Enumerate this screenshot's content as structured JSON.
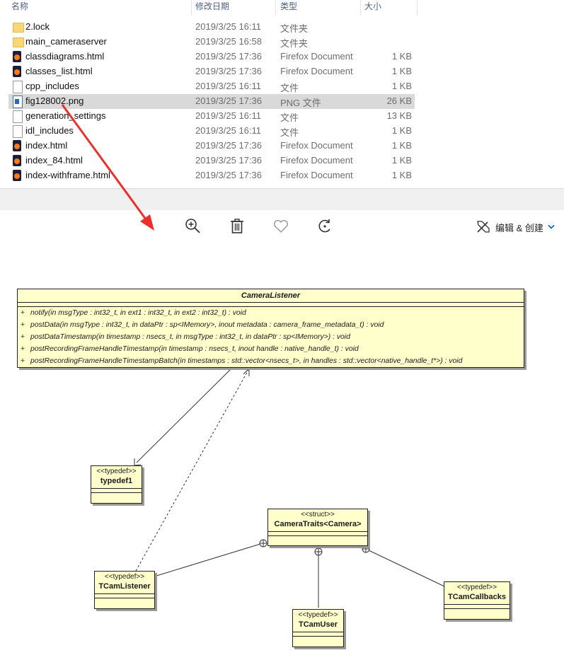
{
  "explorer": {
    "columns": {
      "name": "名称",
      "date": "修改日期",
      "type": "类型",
      "size": "大小"
    },
    "files": [
      {
        "icon": "folder-icon",
        "name": "2.lock",
        "date": "2019/3/25 16:11",
        "type": "文件夹",
        "size": ""
      },
      {
        "icon": "folder-icon",
        "name": "main_cameraserver",
        "date": "2019/3/25 16:58",
        "type": "文件夹",
        "size": ""
      },
      {
        "icon": "firefox-html-icon",
        "name": "classdiagrams.html",
        "date": "2019/3/25 17:36",
        "type": "Firefox Document",
        "size": "1 KB"
      },
      {
        "icon": "firefox-html-icon",
        "name": "classes_list.html",
        "date": "2019/3/25 17:36",
        "type": "Firefox Document",
        "size": "1 KB"
      },
      {
        "icon": "file-icon",
        "name": "cpp_includes",
        "date": "2019/3/25 16:11",
        "type": "文件",
        "size": "1 KB"
      },
      {
        "icon": "png-image-icon",
        "name": "fig128002.png",
        "date": "2019/3/25 17:36",
        "type": "PNG 文件",
        "size": "26 KB",
        "selected": true
      },
      {
        "icon": "file-icon",
        "name": "generation_settings",
        "date": "2019/3/25 16:11",
        "type": "文件",
        "size": "13 KB"
      },
      {
        "icon": "file-icon",
        "name": "idl_includes",
        "date": "2019/3/25 16:11",
        "type": "文件",
        "size": "1 KB"
      },
      {
        "icon": "firefox-html-icon",
        "name": "index.html",
        "date": "2019/3/25 17:36",
        "type": "Firefox Document",
        "size": "1 KB"
      },
      {
        "icon": "firefox-html-icon",
        "name": "index_84.html",
        "date": "2019/3/25 17:36",
        "type": "Firefox Document",
        "size": "1 KB"
      },
      {
        "icon": "firefox-html-icon",
        "name": "index-withframe.html",
        "date": "2019/3/25 17:36",
        "type": "Firefox Document",
        "size": "1 KB"
      }
    ]
  },
  "viewer": {
    "toolbar": {
      "zoom_icon": "zoom-in-icon",
      "delete_icon": "trash-icon",
      "favorite_icon": "heart-icon",
      "rotate_icon": "rotate-icon",
      "edit_create_label": "编辑 & 创建"
    }
  },
  "diagram": {
    "camera_listener": {
      "name": "CameraListener",
      "methods": [
        {
          "visibility": "+",
          "signature": "notify(in msgType : int32_t, in ext1 : int32_t, in ext2 : int32_t) : void"
        },
        {
          "visibility": "+",
          "signature": "postData(in msgType : int32_t, in dataPtr : sp<IMemory>, inout metadata : camera_frame_metadata_t) : void"
        },
        {
          "visibility": "+",
          "signature": "postDataTimestamp(in timestamp : nsecs_t, in msgType : int32_t, in dataPtr : sp<IMemory>) : void"
        },
        {
          "visibility": "+",
          "signature": "postRecordingFrameHandleTimestamp(in timestamp : nsecs_t, inout handle : native_handle_t) : void"
        },
        {
          "visibility": "+",
          "signature": "postRecordingFrameHandleTimestampBatch(in timestamps : std::vector<nsecs_t>, in handles : std::vector<native_handle_t*>) : void"
        }
      ]
    },
    "typedef1": {
      "stereotype": "<<typedef>>",
      "name": "typedef1"
    },
    "camera_traits": {
      "stereotype": "<<struct>>",
      "name": "CameraTraits<Camera>"
    },
    "tcam_listener": {
      "stereotype": "<<typedef>>",
      "name": "TCamListener"
    },
    "tcam_user": {
      "stereotype": "<<typedef>>",
      "name": "TCamUser"
    },
    "tcam_callbacks": {
      "stereotype": "<<typedef>>",
      "name": "TCamCallbacks"
    }
  },
  "colors": {
    "uml_fill": "#ffffcc",
    "selection": "#d9d9d9",
    "annotation_arrow": "#e8312c",
    "toolbar_accent": "#0063b1"
  }
}
